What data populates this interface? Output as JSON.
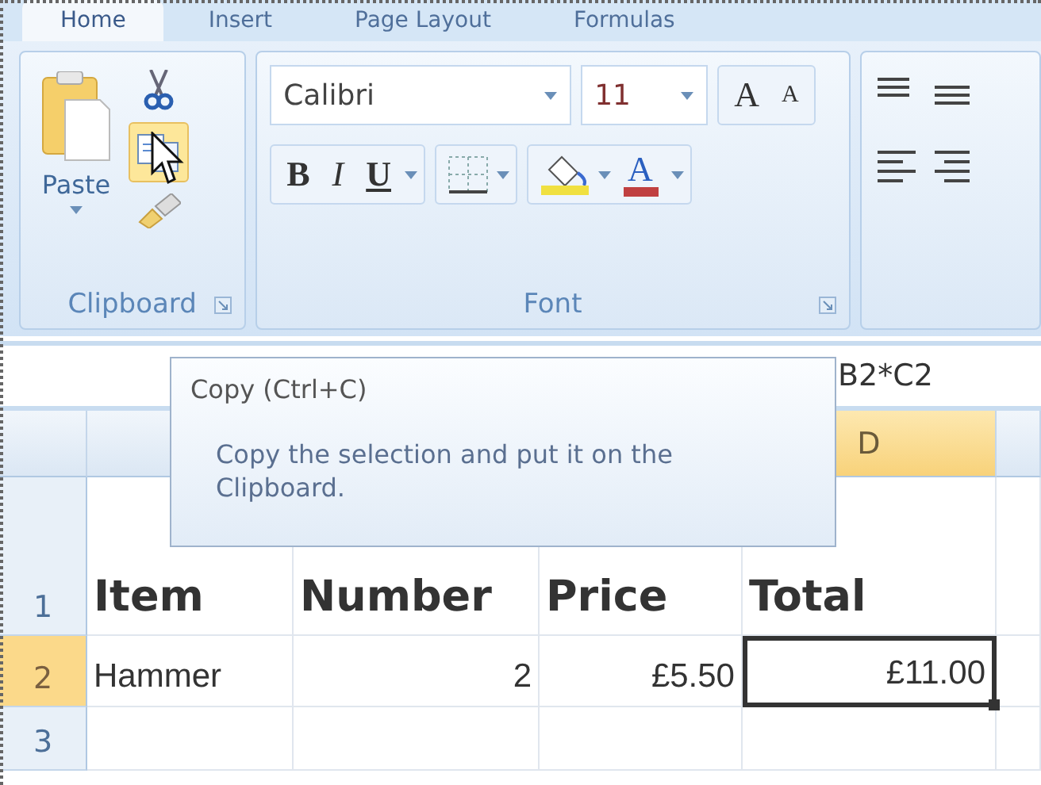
{
  "tabs": [
    {
      "label": "Home",
      "selected": true
    },
    {
      "label": "Insert",
      "selected": false
    },
    {
      "label": "Page Layout",
      "selected": false
    },
    {
      "label": "Formulas",
      "selected": false
    }
  ],
  "clipboard": {
    "paste_label": "Paste",
    "copy_highlighted": true,
    "group_label": "Clipboard"
  },
  "font": {
    "font_name": "Calibri",
    "font_size": "11",
    "grow": "A",
    "shrink": "A",
    "bold": "B",
    "italic": "I",
    "underline": "U",
    "font_color_letter": "A",
    "group_label": "Font"
  },
  "tooltip": {
    "title": "Copy (Ctrl+C)",
    "description": "Copy the selection and put it on the Clipboard."
  },
  "formula_bar": {
    "formula": "B2*C2"
  },
  "column_headers": [
    {
      "letter": "D",
      "selected": true
    }
  ],
  "rows": [
    {
      "number": "1",
      "selected": false,
      "cells": [
        {
          "text": "Item",
          "kind": "text",
          "selected": false
        },
        {
          "text": "Number",
          "kind": "text",
          "selected": false
        },
        {
          "text": "Price",
          "kind": "text",
          "selected": false
        },
        {
          "text": "Total",
          "kind": "text",
          "selected": false
        }
      ]
    },
    {
      "number": "2",
      "selected": true,
      "cells": [
        {
          "text": "Hammer",
          "kind": "text",
          "selected": false
        },
        {
          "text": "2",
          "kind": "number",
          "selected": false
        },
        {
          "text": "£5.50",
          "kind": "number",
          "selected": false
        },
        {
          "text": "£11.00",
          "kind": "number",
          "selected": true
        }
      ]
    },
    {
      "number": "3",
      "selected": false,
      "cells": []
    }
  ]
}
